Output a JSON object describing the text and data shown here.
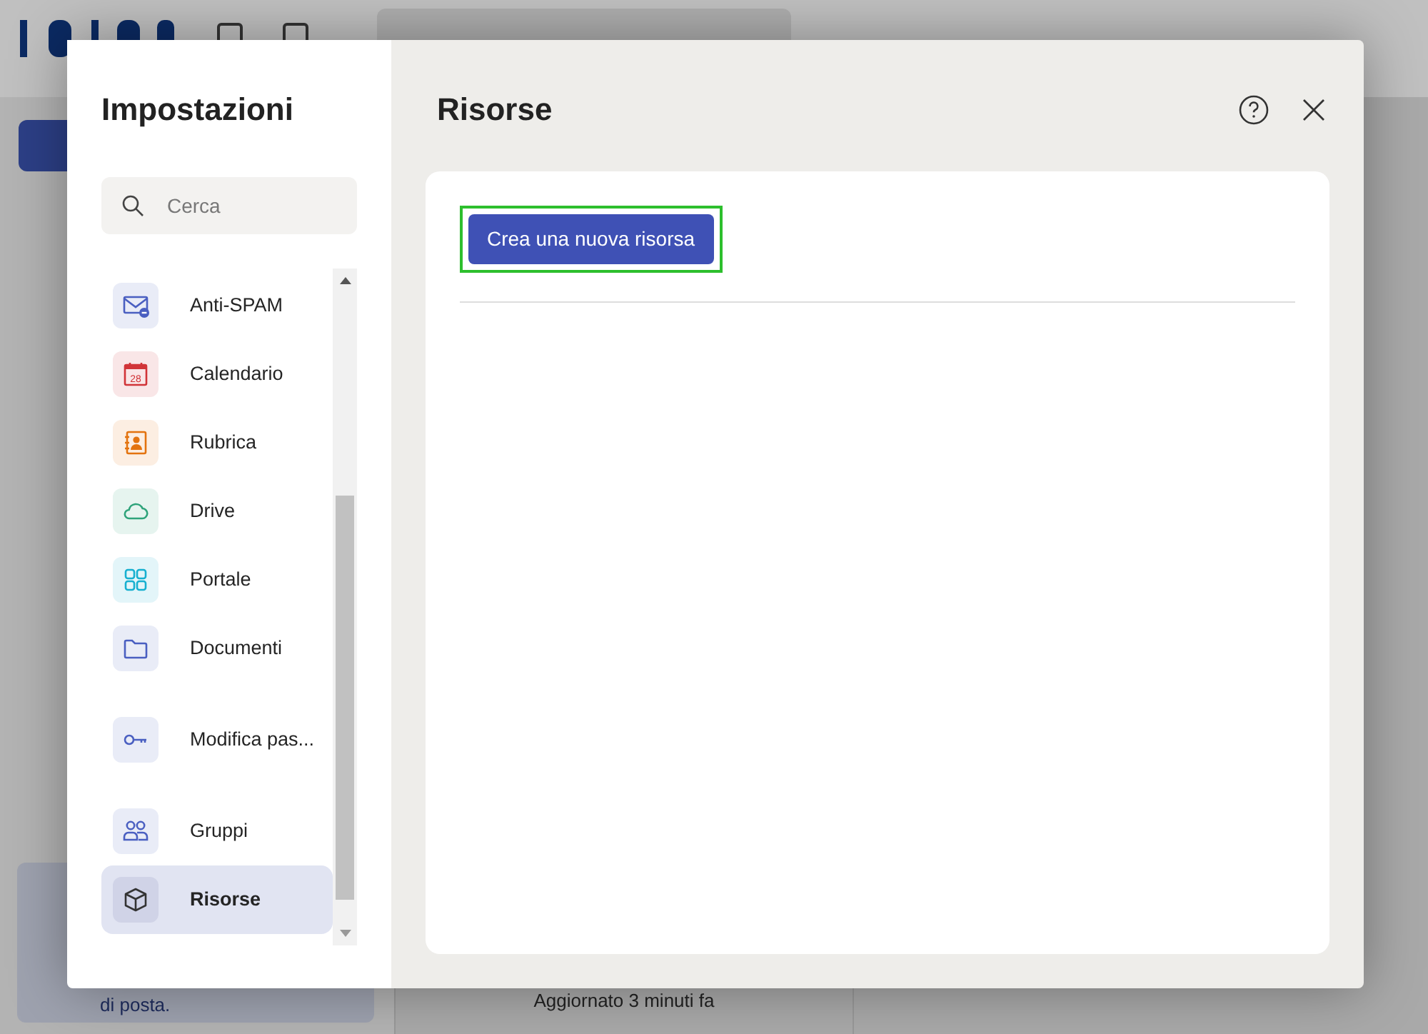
{
  "background": {
    "promo_text": "di posta.",
    "status": "Aggiornato 3 minuti fa"
  },
  "dialog": {
    "title": "Impostazioni",
    "search": {
      "placeholder": "Cerca"
    },
    "items": [
      {
        "label": "Anti-SPAM",
        "kind": "mail",
        "color": "#4a5fc1",
        "selected": false,
        "gap_before": false
      },
      {
        "label": "Calendario",
        "kind": "calendar",
        "badge": "28",
        "color": "#d13438",
        "selected": false,
        "gap_before": false
      },
      {
        "label": "Rubrica",
        "kind": "contacts",
        "color": "#e3730f",
        "selected": false,
        "gap_before": false
      },
      {
        "label": "Drive",
        "kind": "cloud",
        "color": "#2ea37a",
        "selected": false,
        "gap_before": false
      },
      {
        "label": "Portale",
        "kind": "grid",
        "color": "#17b0d0",
        "selected": false,
        "gap_before": false
      },
      {
        "label": "Documenti",
        "kind": "folder",
        "color": "#4a5fc1",
        "selected": false,
        "gap_before": false
      },
      {
        "label": "Modifica pas...",
        "kind": "key",
        "color": "#4a5fc1",
        "selected": false,
        "gap_before": true
      },
      {
        "label": "Gruppi",
        "kind": "people",
        "color": "#4a5fc1",
        "selected": false,
        "gap_before": true
      },
      {
        "label": "Risorse",
        "kind": "cube",
        "color": "#333333",
        "selected": true,
        "gap_before": false
      }
    ],
    "page_title": "Risorse",
    "create_button": {
      "label": "Crea una nuova risorsa",
      "highlighted": true
    }
  }
}
